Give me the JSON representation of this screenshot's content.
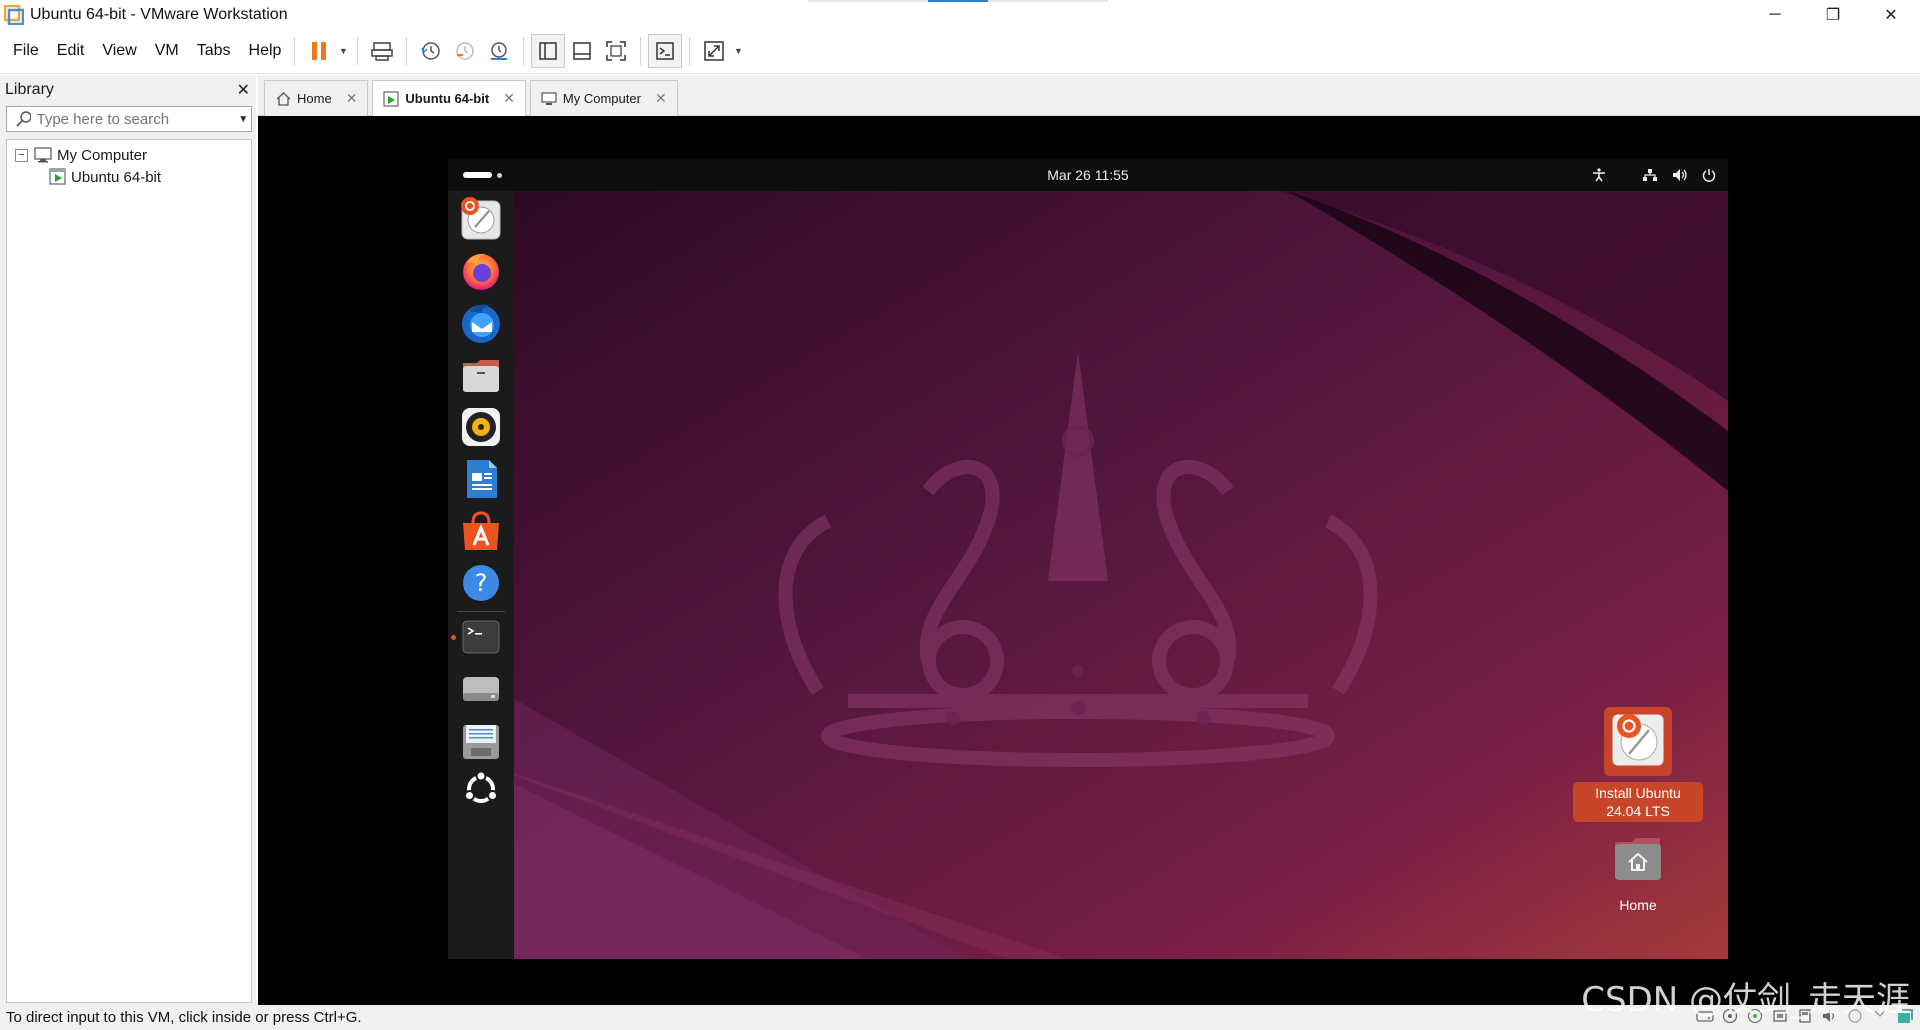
{
  "window": {
    "title": "Ubuntu 64-bit - VMware Workstation",
    "controls": {
      "minimize": "─",
      "restore": "❐",
      "close": "✕"
    }
  },
  "menu": [
    "File",
    "Edit",
    "View",
    "VM",
    "Tabs",
    "Help"
  ],
  "toolbar": {
    "buttons": [
      "pause-icon",
      "send-ctrl-alt-del-icon",
      "snapshot-icon",
      "revert-snapshot-icon",
      "snapshot-manager-icon",
      "show-library-icon",
      "thumbnail-bar-icon",
      "full-screen-icon",
      "console-view-icon",
      "stretch-icon"
    ]
  },
  "library": {
    "title": "Library",
    "close": "✕",
    "search_placeholder": "Type here to search",
    "tree": {
      "root_toggle": "−",
      "root": "My Computer",
      "children": [
        "Ubuntu 64-bit"
      ]
    }
  },
  "tabs": [
    {
      "label": "Home",
      "icon": "home-icon",
      "active": false
    },
    {
      "label": "Ubuntu 64-bit",
      "icon": "vm-running-icon",
      "active": true
    },
    {
      "label": "My Computer",
      "icon": "computer-icon",
      "active": false
    }
  ],
  "tab_close": "✕",
  "ubuntu": {
    "clock": "Mar 26  11:55",
    "tray": [
      "accessibility-icon",
      "network-icon",
      "volume-icon",
      "power-icon"
    ],
    "dock": [
      "installer-icon",
      "firefox-icon",
      "thunderbird-icon",
      "files-icon",
      "rhythmbox-icon",
      "writer-icon",
      "app-center-icon",
      "help-icon",
      "terminal-icon",
      "drive-icon",
      "disk-image-icon",
      "show-apps-icon"
    ],
    "desktop_icons": {
      "install": {
        "label_line1": "Install Ubuntu",
        "label_line2": "24.04 LTS"
      },
      "home": {
        "label": "Home"
      }
    }
  },
  "statusbar": {
    "text": "To direct input to this VM, click inside or press Ctrl+G."
  },
  "watermark": "CSDN @仗剑_走天涯",
  "colors": {
    "accent_orange": "#e95420",
    "desktop_base": "#2c0a26",
    "selection": "#c9452a"
  }
}
